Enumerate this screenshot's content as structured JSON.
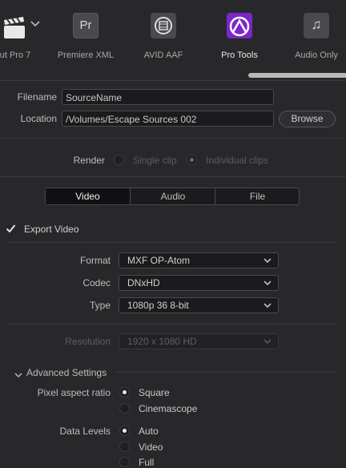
{
  "presets": {
    "items": [
      {
        "label": "ut Pro 7",
        "icon": "final-cut-clapper-icon"
      },
      {
        "label": "Premiere XML",
        "icon": "premiere-pr-icon",
        "glyph": "Pr"
      },
      {
        "label": "AVID AAF",
        "icon": "avid-film-icon"
      },
      {
        "label": "Pro Tools",
        "icon": "pro-tools-icon"
      },
      {
        "label": "Audio Only",
        "icon": "music-note-icon",
        "glyph": "♫"
      }
    ],
    "active": "Pro Tools",
    "accent": "#8a2bd0"
  },
  "file": {
    "filename_label": "Filename",
    "filename_value": "SourceName",
    "location_label": "Location",
    "location_value": "/Volumes/Escape Sources 002",
    "browse_label": "Browse"
  },
  "render": {
    "label": "Render",
    "options": [
      "Single clip",
      "Individual clips"
    ],
    "selected": "Individual clips"
  },
  "tabs": [
    "Video",
    "Audio",
    "File"
  ],
  "active_tab": "Video",
  "export_video": {
    "label": "Export Video",
    "checked": true
  },
  "video": {
    "format_label": "Format",
    "format_value": "MXF OP-Atom",
    "codec_label": "Codec",
    "codec_value": "DNxHD",
    "type_label": "Type",
    "type_value": "1080p 36 8-bit",
    "resolution_label": "Resolution",
    "resolution_value": "1920 x 1080 HD"
  },
  "advanced": {
    "label": "Advanced Settings",
    "pixel_aspect_label": "Pixel aspect ratio",
    "pixel_aspect_options": [
      "Square",
      "Cinemascope"
    ],
    "pixel_aspect_selected": "Square",
    "data_levels_label": "Data Levels",
    "data_levels_options": [
      "Auto",
      "Video",
      "Full"
    ],
    "data_levels_selected": "Auto"
  }
}
